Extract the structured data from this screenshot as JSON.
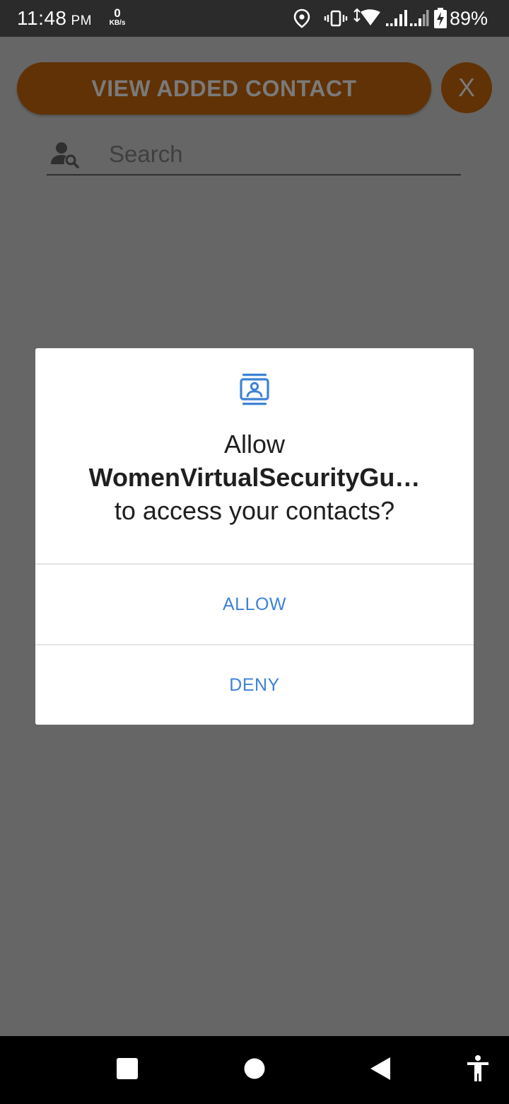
{
  "status_bar": {
    "time": "11:48",
    "time_suffix": "PM",
    "net_speed_value": "0",
    "net_speed_unit": "KB/s",
    "battery_percent": "89%",
    "icons": [
      "location-icon",
      "vibrate-icon",
      "wifi-icon",
      "signal-icon",
      "signal-icon-2",
      "battery-charging-icon"
    ]
  },
  "app": {
    "view_contacts_label": "VIEW ADDED CONTACT",
    "close_label": "X",
    "search_placeholder": "Search",
    "search_value": ""
  },
  "dialog": {
    "icon": "contacts-icon",
    "prefix": "Allow",
    "app_name": "WomenVirtualSecurityGu…",
    "suffix": "to access your contacts?",
    "allow_label": "ALLOW",
    "deny_label": "DENY",
    "accent_color": "#3d82d6"
  },
  "nav_bar": {
    "buttons": [
      "recents-icon",
      "home-icon",
      "back-icon",
      "accessibility-icon"
    ]
  },
  "colors": {
    "scrim_background": "#666666",
    "button_fill_dimmed": "#613205",
    "status_bar": "#2b2b2b",
    "nav_bar": "#000000"
  }
}
